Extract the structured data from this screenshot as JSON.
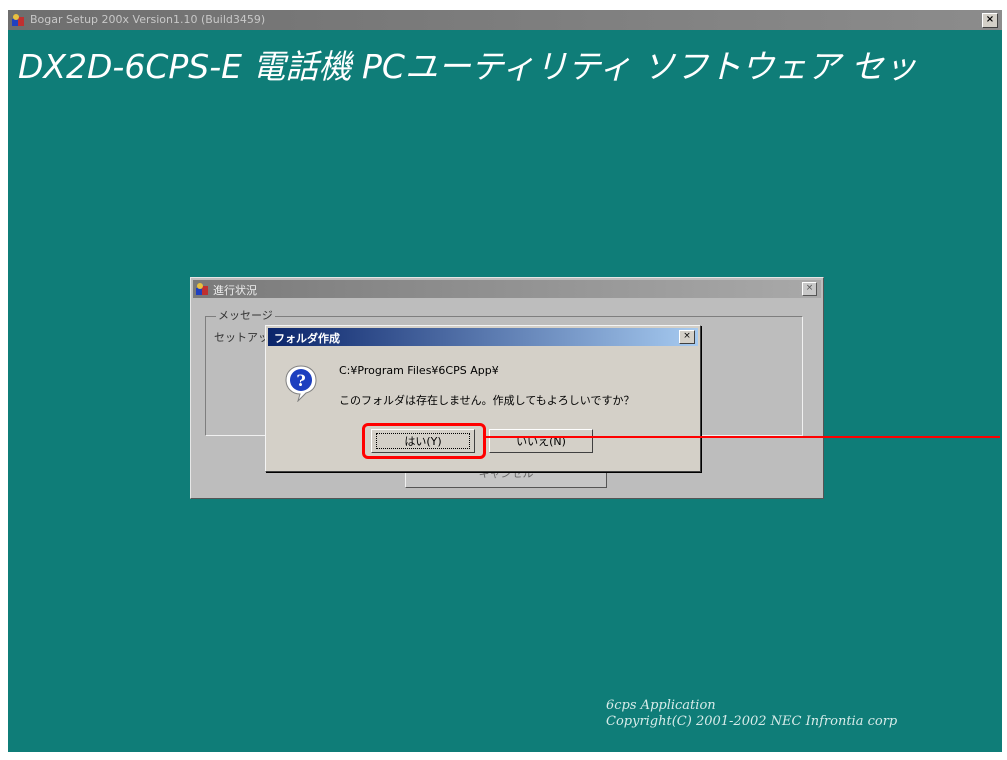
{
  "installer": {
    "title": "Bogar Setup 200x Version1.10 (Build3459)",
    "close_glyph": "×",
    "banner": "DX2D-6CPS-E 電話機 PCユーティリティ ソフトウェア セッ",
    "footer_app": "6cps Application",
    "footer_copyright": "Copyright(C) 2001-2002 NEC Infrontia corp",
    "background_color": "#0f7d78"
  },
  "progress_dialog": {
    "title": "進行状況",
    "close_glyph": "×",
    "message_label": "メッセージ",
    "message_text": "セットアッ",
    "button_label": "キャンセル"
  },
  "folder_dialog": {
    "title": "フォルダ作成",
    "close_glyph": "×",
    "icon": "question-icon",
    "path": "C:¥Program Files¥6CPS App¥",
    "question": "このフォルダは存在しません。作成してもよろしいですか？",
    "yes_label": "はい(Y)",
    "no_label": "いいえ(N)"
  },
  "annotation": {
    "color": "#ff0000",
    "target": "yes-button"
  }
}
